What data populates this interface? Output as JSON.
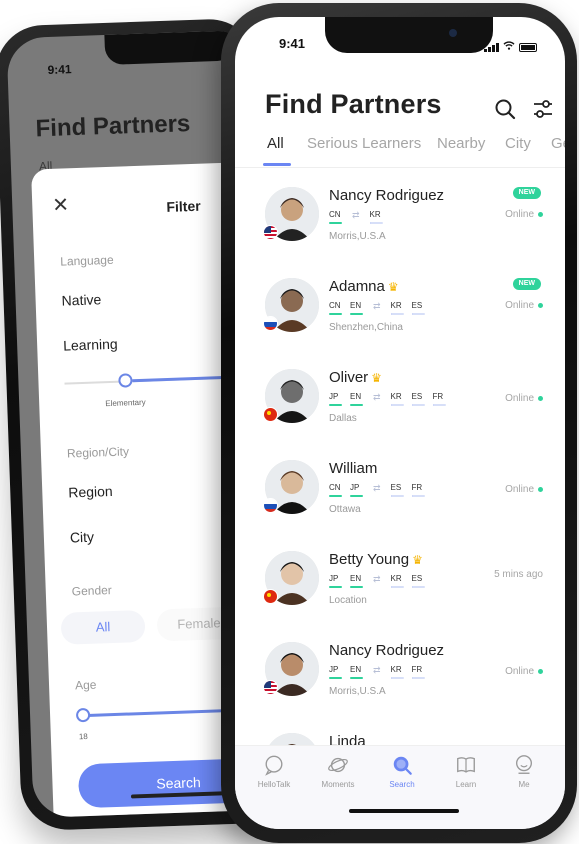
{
  "back_screen": {
    "status_time": "9:41",
    "title": "Find Partners",
    "faded_tab": "All",
    "filter": {
      "close_icon": "close-icon",
      "title": "Filter",
      "language_label": "Language",
      "native_label": "Native",
      "learning_label": "Learning",
      "proficiency_caption": "Elementary",
      "region_city_label": "Region/City",
      "region_label": "Region",
      "city_label": "City",
      "gender_label": "Gender",
      "gender_options": [
        "All",
        "Female"
      ],
      "gender_selected": "All",
      "age_label": "Age",
      "age_min": "18",
      "search_button": "Search"
    }
  },
  "front_screen": {
    "status_time": "9:41",
    "title": "Find Partners",
    "tabs": [
      "All",
      "Serious Learners",
      "Nearby",
      "City",
      "Ge"
    ],
    "active_tab": "All",
    "partners": [
      {
        "name": "Nancy Rodriguez",
        "crown": false,
        "native": [
          "CN"
        ],
        "learning": [
          "KR"
        ],
        "learning_levels": [
          0.5
        ],
        "location": "Morris,U.S.A",
        "badge": "NEW",
        "status": "Online",
        "online": true,
        "flag": "us"
      },
      {
        "name": "Adamna",
        "crown": true,
        "native": [
          "CN",
          "EN"
        ],
        "learning": [
          "KR",
          "ES"
        ],
        "learning_levels": [
          0.5,
          0.3
        ],
        "location": "Shenzhen,China",
        "badge": "NEW",
        "status": "Online",
        "online": true,
        "flag": "ru"
      },
      {
        "name": "Oliver",
        "crown": true,
        "native": [
          "JP",
          "EN"
        ],
        "learning": [
          "KR",
          "ES",
          "FR"
        ],
        "learning_levels": [
          0.5,
          0.3,
          0.3
        ],
        "location": "Dallas",
        "badge": "",
        "status": "Online",
        "online": true,
        "flag": "cn"
      },
      {
        "name": "William",
        "crown": false,
        "native": [
          "CN",
          "JP"
        ],
        "learning": [
          "ES",
          "FR"
        ],
        "learning_levels": [
          0.5,
          0.3
        ],
        "location": "Ottawa",
        "badge": "",
        "status": "Online",
        "online": true,
        "flag": "ru"
      },
      {
        "name": "Betty Young",
        "crown": true,
        "native": [
          "JP",
          "EN"
        ],
        "learning": [
          "KR",
          "ES"
        ],
        "learning_levels": [
          0.5,
          0.3
        ],
        "location": "Location",
        "badge": "",
        "status": "5 mins ago",
        "online": false,
        "flag": "cn"
      },
      {
        "name": "Nancy Rodriguez",
        "crown": false,
        "native": [
          "JP",
          "EN"
        ],
        "learning": [
          "KR",
          "FR"
        ],
        "learning_levels": [
          0.5,
          0.3
        ],
        "location": "Morris,U.S.A",
        "badge": "",
        "status": "Online",
        "online": true,
        "flag": "us"
      },
      {
        "name": "Linda",
        "crown": false,
        "native": [],
        "learning": [],
        "learning_levels": [],
        "location": "",
        "badge": "",
        "status": "",
        "online": false,
        "flag": ""
      }
    ],
    "bottom_nav": [
      {
        "label": "HelloTalk",
        "icon": "chat-bubble-icon",
        "active": false
      },
      {
        "label": "Moments",
        "icon": "planet-icon",
        "active": false
      },
      {
        "label": "Search",
        "icon": "search-icon",
        "active": true
      },
      {
        "label": "Learn",
        "icon": "book-icon",
        "active": false
      },
      {
        "label": "Me",
        "icon": "person-icon",
        "active": false
      }
    ]
  },
  "colors": {
    "accent": "#6b86f3",
    "online_green": "#2fd39b",
    "crown_gold": "#f5b400"
  }
}
